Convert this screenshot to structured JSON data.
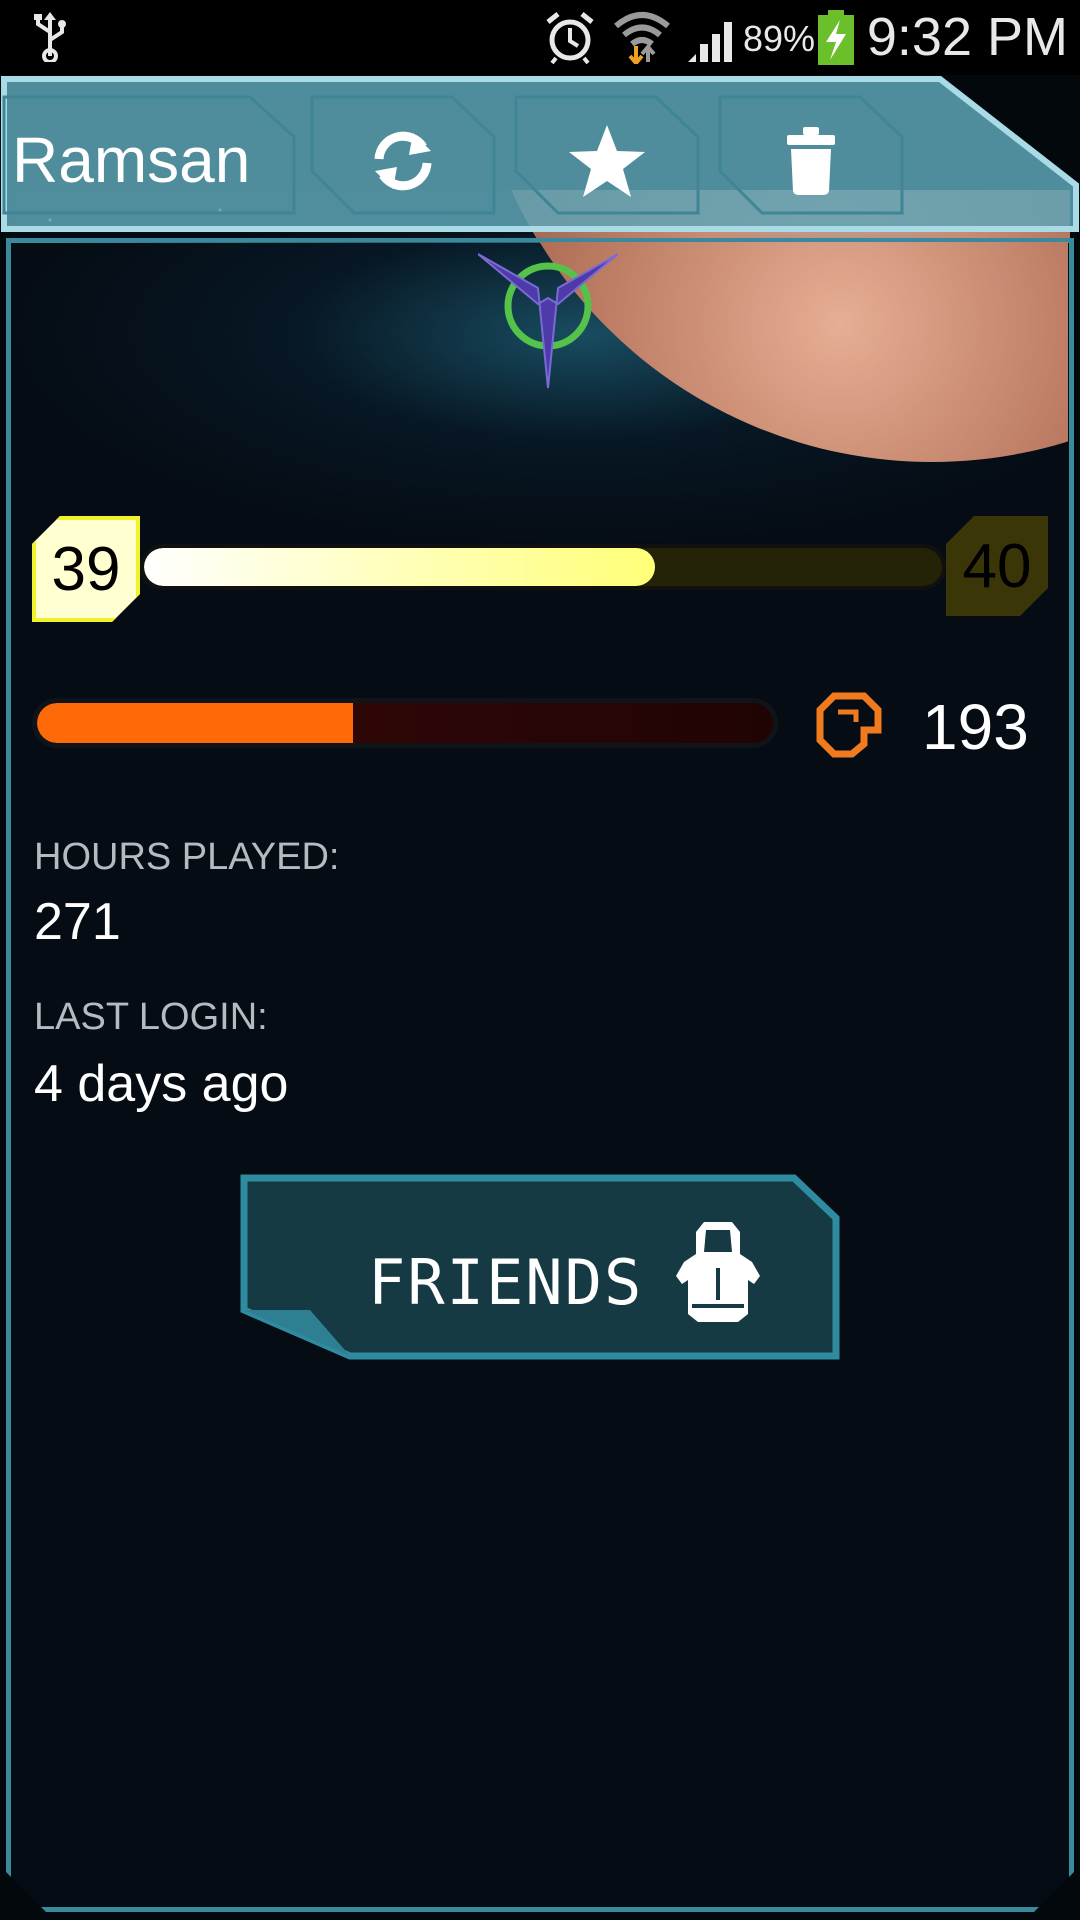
{
  "status_bar": {
    "battery_percent": "89%",
    "time": "9:32 PM",
    "icons": [
      "usb-icon",
      "alarm-icon",
      "wifi-icon",
      "signal-icon",
      "battery-charging-icon"
    ]
  },
  "header": {
    "player_name": "Ramsan",
    "buttons": [
      {
        "name": "refresh-button",
        "icon": "refresh-icon"
      },
      {
        "name": "favorite-button",
        "icon": "star-icon"
      },
      {
        "name": "delete-button",
        "icon": "trash-icon"
      }
    ]
  },
  "profile": {
    "faction_emblem": "faction-emblem-icon",
    "current_level": "39",
    "next_level": "40",
    "xp_progress": 0.64,
    "secondary_progress": 0.43,
    "credits": "193",
    "hours_played_label": "HOURS PLAYED:",
    "hours_played_value": "271",
    "last_login_label": "LAST LOGIN:",
    "last_login_value": "4 days ago"
  },
  "friends_button": {
    "label": "FRIENDS",
    "icon": "pilot-icon"
  },
  "colors": {
    "frame": "#3a8a9c",
    "header_fill": "#5ea4b6",
    "xp_fill": "#ffff78",
    "level_badge": "#f2f22c",
    "secondary_fill": "#ff6a08",
    "credit_icon": "#f07a1e",
    "button_fill": "#153a44"
  }
}
